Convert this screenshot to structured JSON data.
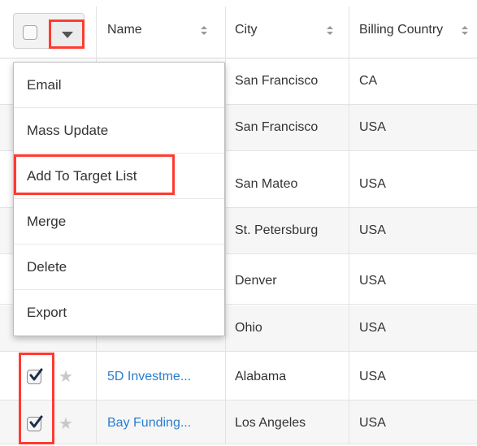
{
  "columns": {
    "name": "Name",
    "city": "City",
    "billing_country": "Billing Country"
  },
  "menu": {
    "items": [
      "Email",
      "Mass Update",
      "Add To Target List",
      "Merge",
      "Delete",
      "Export"
    ]
  },
  "rows": [
    {
      "name": "",
      "city": "San Francisco",
      "country": "CA"
    },
    {
      "name": "",
      "city": "San Francisco",
      "country": "USA"
    },
    {
      "name": "",
      "city": "San Mateo",
      "country": "USA"
    },
    {
      "name": "",
      "city": "St. Petersburg",
      "country": "USA"
    },
    {
      "name": "",
      "city": "Denver",
      "country": "USA"
    },
    {
      "name": "",
      "city": "Ohio",
      "country": "USA"
    },
    {
      "name": "5D Investme...",
      "city": "Alabama",
      "country": "USA",
      "checked": true
    },
    {
      "name": "Bay Funding...",
      "city": "Los Angeles",
      "country": "USA",
      "checked": true
    }
  ],
  "colors": {
    "highlight": "#ff3b30",
    "link": "#2a7dd0",
    "header_border": "#d9d9d9"
  },
  "icons": {
    "checkbox": "checkbox-icon",
    "dropdown": "caret-down-icon",
    "sort": "sort-icon",
    "star": "star-icon",
    "checkmark": "checkmark-icon"
  }
}
